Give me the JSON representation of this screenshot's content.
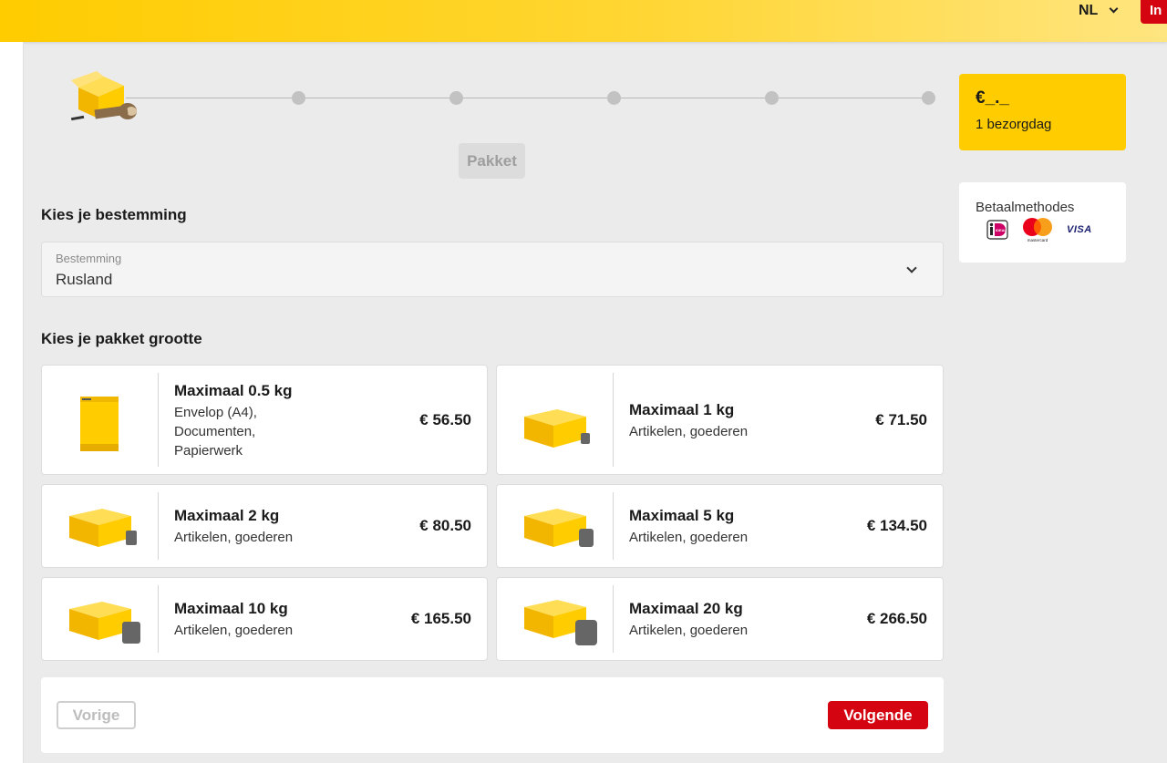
{
  "header": {
    "language": "NL",
    "login_label": "In"
  },
  "progress": {
    "current_step_label": "Pakket"
  },
  "destination": {
    "heading": "Kies je bestemming",
    "field_label": "Bestemming",
    "selected_value": "Rusland"
  },
  "sizes": {
    "heading": "Kies je pakket grootte",
    "options": [
      {
        "title": "Maximaal 0.5 kg",
        "description": "Envelop (A4), Documenten, Papierwerk",
        "price": "€ 56.50",
        "icon": "envelope-icon"
      },
      {
        "title": "Maximaal 1 kg",
        "description": "Artikelen, goederen",
        "price": "€ 71.50",
        "icon": "box-weight-icon"
      },
      {
        "title": "Maximaal 2 kg",
        "description": "Artikelen, goederen",
        "price": "€ 80.50",
        "icon": "box-weight-icon",
        "weight": "2"
      },
      {
        "title": "Maximaal 5 kg",
        "description": "Artikelen, goederen",
        "price": "€ 134.50",
        "icon": "box-weight-icon",
        "weight": "5"
      },
      {
        "title": "Maximaal 10 kg",
        "description": "Artikelen, goederen",
        "price": "€ 165.50",
        "icon": "box-weight-icon",
        "weight": "10"
      },
      {
        "title": "Maximaal 20 kg",
        "description": "Artikelen, goederen",
        "price": "€ 266.50",
        "icon": "box-weight-icon",
        "weight": "20"
      }
    ]
  },
  "navigation": {
    "prev_label": "Vorige",
    "next_label": "Volgende"
  },
  "summary": {
    "price": "€_._",
    "delivery_days": "1 bezorgdag"
  },
  "payment": {
    "title": "Betaalmethodes",
    "methods": [
      "ideal-icon",
      "mastercard-icon",
      "visa-icon"
    ],
    "mastercard_text": "mastercard",
    "visa_text": "VISA",
    "ideal_text": "iDEAL"
  },
  "colors": {
    "brand_yellow": "#ffcc00",
    "brand_red": "#d40511"
  }
}
